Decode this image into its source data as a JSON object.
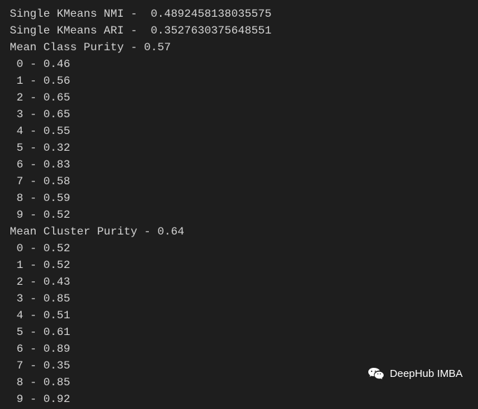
{
  "metrics": {
    "nmi_label": "Single KMeans NMI -  ",
    "nmi_value": "0.4892458138035575",
    "ari_label": "Single KMeans ARI -  ",
    "ari_value": "0.3527630375648551",
    "mean_class_purity_label": "Mean Class Purity - ",
    "mean_class_purity_value": "0.57",
    "class_purity": [
      {
        "idx": "0",
        "val": "0.46"
      },
      {
        "idx": "1",
        "val": "0.56"
      },
      {
        "idx": "2",
        "val": "0.65"
      },
      {
        "idx": "3",
        "val": "0.65"
      },
      {
        "idx": "4",
        "val": "0.55"
      },
      {
        "idx": "5",
        "val": "0.32"
      },
      {
        "idx": "6",
        "val": "0.83"
      },
      {
        "idx": "7",
        "val": "0.58"
      },
      {
        "idx": "8",
        "val": "0.59"
      },
      {
        "idx": "9",
        "val": "0.52"
      }
    ],
    "mean_cluster_purity_label": "Mean Cluster Purity - ",
    "mean_cluster_purity_value": "0.64",
    "cluster_purity": [
      {
        "idx": "0",
        "val": "0.52"
      },
      {
        "idx": "1",
        "val": "0.52"
      },
      {
        "idx": "2",
        "val": "0.43"
      },
      {
        "idx": "3",
        "val": "0.85"
      },
      {
        "idx": "4",
        "val": "0.51"
      },
      {
        "idx": "5",
        "val": "0.61"
      },
      {
        "idx": "6",
        "val": "0.89"
      },
      {
        "idx": "7",
        "val": "0.35"
      },
      {
        "idx": "8",
        "val": "0.85"
      },
      {
        "idx": "9",
        "val": "0.92"
      }
    ]
  },
  "watermark": {
    "text": "DeepHub IMBA",
    "icon_name": "wechat-icon"
  }
}
